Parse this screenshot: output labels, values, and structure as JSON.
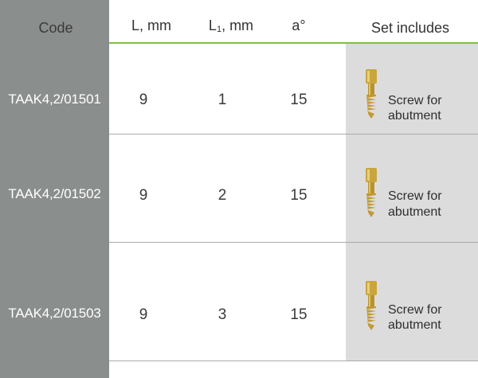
{
  "headers": {
    "code": "Code",
    "length": "L, mm",
    "length1_base": "L",
    "length1_sub": "1",
    "length1_unit": ", mm",
    "angle": "a°",
    "set": "Set includes"
  },
  "rows": [
    {
      "code": "TAAK4,2/01501",
      "l": "9",
      "l1": "1",
      "a": "15",
      "set_line1": "Screw for",
      "set_line2": "abutment",
      "set_icon": "screw-icon"
    },
    {
      "code": "TAAK4,2/01502",
      "l": "9",
      "l1": "2",
      "a": "15",
      "set_line1": "Screw for",
      "set_line2": "abutment",
      "set_icon": "screw-icon"
    },
    {
      "code": "TAAK4,2/01503",
      "l": "9",
      "l1": "3",
      "a": "15",
      "set_line1": "Screw for",
      "set_line2": "abutment",
      "set_icon": "screw-icon"
    }
  ],
  "colors": {
    "code_column": "#8a8e8c",
    "header_line": "#7dc142",
    "set_column": "#dcdcdc",
    "screw_gold": "#c9a53c"
  }
}
